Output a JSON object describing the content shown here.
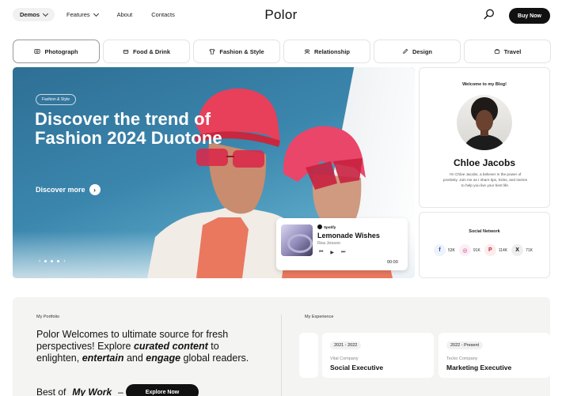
{
  "nav": {
    "items": [
      {
        "label": "Demos",
        "has_dropdown": true,
        "active": true
      },
      {
        "label": "Features",
        "has_dropdown": true,
        "active": false
      },
      {
        "label": "About",
        "has_dropdown": false,
        "active": false
      },
      {
        "label": "Contacts",
        "has_dropdown": false,
        "active": false
      }
    ],
    "logo": "Polor",
    "search_icon": "search-icon",
    "buy_label": "Buy Now"
  },
  "categories": [
    {
      "label": "Photograph",
      "icon": "photo-icon",
      "active": true
    },
    {
      "label": "Food & Drink",
      "icon": "food-icon",
      "active": false
    },
    {
      "label": "Fashion & Style",
      "icon": "shirt-icon",
      "active": false
    },
    {
      "label": "Relationship",
      "icon": "relationship-icon",
      "active": false
    },
    {
      "label": "Design",
      "icon": "pen-icon",
      "active": false
    },
    {
      "label": "Travel",
      "icon": "travel-icon",
      "active": false
    }
  ],
  "hero": {
    "tag": "Fashion & Style",
    "title": "Discover the trend of Fashion 2024 Duotone",
    "cta": "Discover more",
    "pager_prev": "‹",
    "pager_next": "›"
  },
  "player": {
    "brand": "Spotify",
    "title": "Lemonade Wishes",
    "artist": "Rea Jesson",
    "time": "00:00"
  },
  "profile": {
    "welcome": "Welcome to my Blog!",
    "name": "Chloe Jacobs",
    "bio": "I'm Chloe Jacobs, a believer in the power of positivity. Join me as I share tips, tricks, and stories to help you live your best life."
  },
  "social": {
    "title": "Social Network",
    "items": [
      {
        "icon": "facebook-icon",
        "glyph": "f",
        "count": "53K",
        "color": "#1f4fb5",
        "bg": "#eef2fb"
      },
      {
        "icon": "instagram-icon",
        "glyph": "◎",
        "count": "91K",
        "color": "#c2368a",
        "bg": "#fbeef4"
      },
      {
        "icon": "pinterest-icon",
        "glyph": "P",
        "count": "114K",
        "color": "#d0202e",
        "bg": "#fcecec"
      },
      {
        "icon": "x-icon",
        "glyph": "X",
        "count": "71K",
        "color": "#111111",
        "bg": "#eeeeee"
      }
    ]
  },
  "portfolio": {
    "label": "My Portfolio",
    "text_parts": [
      "Polor Welcomes to ultimate source for fresh perspectives! Explore ",
      "curated content",
      " to enlighten, ",
      "entertain",
      " and ",
      "engage",
      " global readers."
    ],
    "best_prefix": "Best of",
    "best_work": "My Work",
    "dash": "–",
    "explore": "Explore Now"
  },
  "experience": {
    "label": "My Experience",
    "cards": [
      {
        "years": "2021 - 2022",
        "company": "Vital Company",
        "role": "Social Executive"
      },
      {
        "years": "2022 - Present",
        "company": "Tecko Company",
        "role": "Marketing Executive"
      }
    ]
  }
}
